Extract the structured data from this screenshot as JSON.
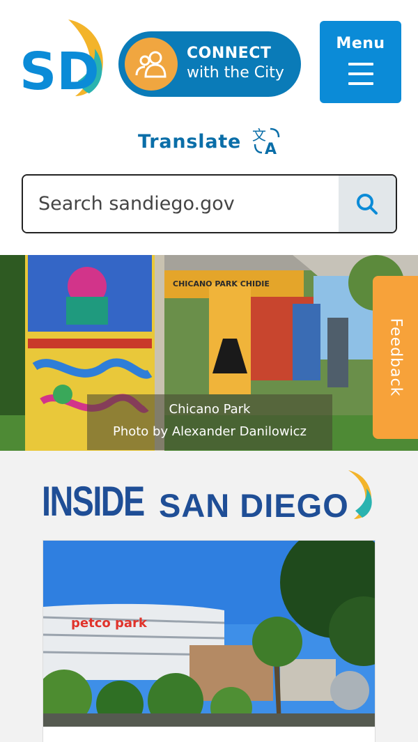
{
  "header": {
    "logo_text": "SD",
    "connect_line1": "CONNECT",
    "connect_line2": "with the City",
    "menu_label": "Menu"
  },
  "translate": {
    "label": "Translate"
  },
  "search": {
    "placeholder": "Search sandiego.gov",
    "value": ""
  },
  "hero": {
    "caption_line1": "Chicano Park",
    "caption_line2": "Photo by Alexander Danilowicz",
    "mural_text": "CHICANO PARK CHIDIE"
  },
  "feedback": {
    "label": "Feedback"
  },
  "inside": {
    "word1": "INSIDE",
    "word2": "SAN DIEGO",
    "card_sign": "petco park"
  },
  "colors": {
    "primary_blue": "#0b8bd7",
    "dark_blue": "#0a7bb8",
    "orange": "#f0a640",
    "feedback_orange": "#f7a23a",
    "teal": "#2ab3b0",
    "brand_navy": "#1f4e96"
  },
  "icons": {
    "people": "people-icon",
    "translate": "translate-icon",
    "search": "search-icon",
    "menu": "hamburger-icon"
  }
}
